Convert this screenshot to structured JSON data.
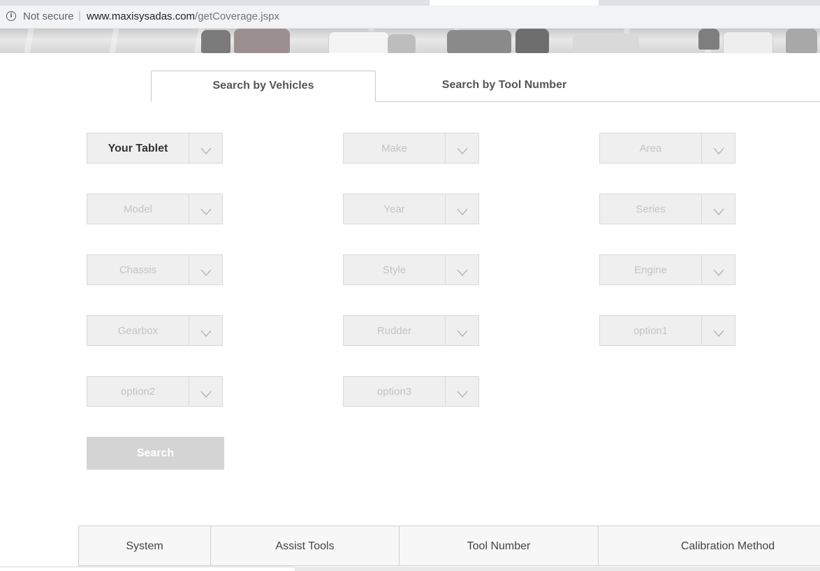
{
  "browser": {
    "security_label": "Not secure",
    "separator": "|",
    "url_host": "www.maxisysadas.com",
    "url_path": "/getCoverage.jspx",
    "info_icon": "info-circle-icon"
  },
  "tabs": {
    "vehicles": "Search by Vehicles",
    "tool_number": "Search by Tool Number",
    "active": "vehicles"
  },
  "selects": {
    "tablet": "Your Tablet",
    "make": "Make",
    "area": "Area",
    "model": "Model",
    "year": "Year",
    "series": "Series",
    "chassis": "Chassis",
    "style": "Style",
    "engine": "Engine",
    "gearbox": "Gearbox",
    "rudder": "Rudder",
    "option1": "option1",
    "option2": "option2",
    "option3": "option3"
  },
  "search_button": "Search",
  "table": {
    "columns": [
      "System",
      "Assist Tools",
      "Tool Number",
      "Calibration Method"
    ]
  },
  "colors": {
    "disabled_text": "#c4c4c4",
    "select_bg": "#efefef",
    "search_button_bg": "#d4d4d4"
  }
}
